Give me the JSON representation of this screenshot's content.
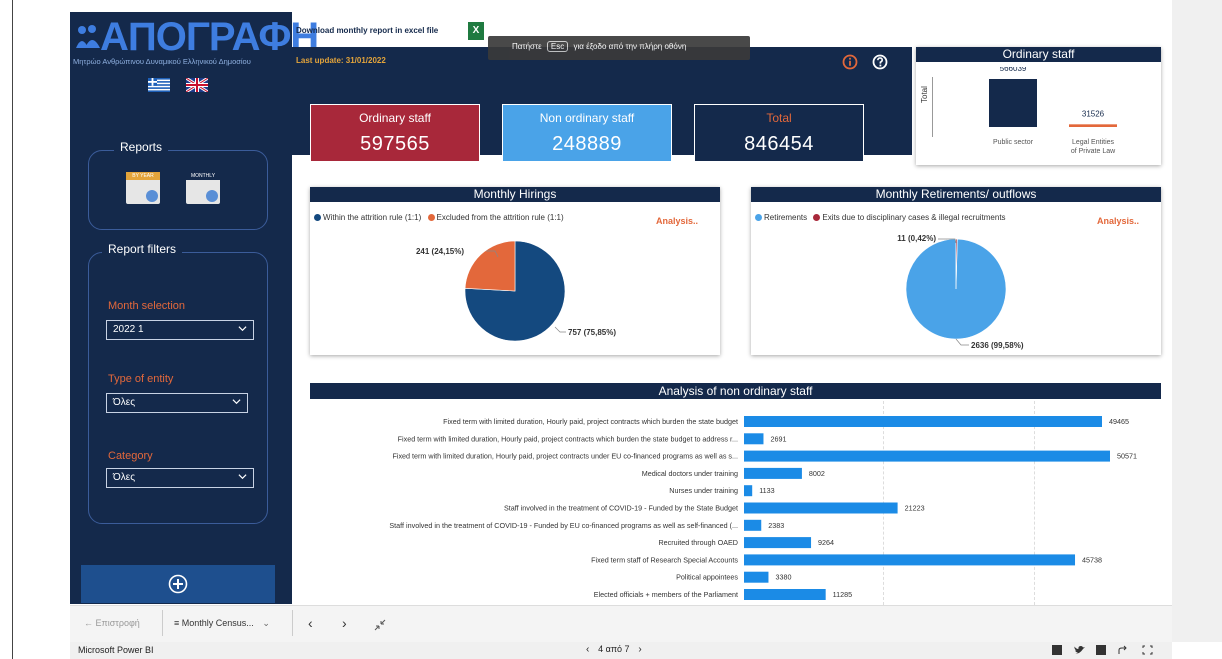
{
  "logo": {
    "title": "ΑΠΟΓΡΑΦΗ",
    "subtitle": "Μητρώο Ανθρώπινου Δυναμικού Ελληνικού Δημοσίου"
  },
  "header": {
    "download_label": "Download monthly report in excel file",
    "excel_icon_letter": "X",
    "last_update": "Last update: 31/01/2022",
    "toast": {
      "before": "Πατήστε",
      "key": "Esc",
      "after": "για έξοδο από την πλήρη οθόνη"
    }
  },
  "sidebar": {
    "reports_title": "Reports",
    "report_icons": [
      {
        "band": "BY YEAR"
      },
      {
        "band": "MONTHLY"
      }
    ],
    "filters_title": "Report filters",
    "filters": [
      {
        "label": "Month selection",
        "value": "2022 1"
      },
      {
        "label": "Type of entity",
        "value": "Όλες"
      },
      {
        "label": "Category",
        "value": "Όλες"
      }
    ]
  },
  "kpis": [
    {
      "title": "Ordinary staff",
      "value": "597565",
      "color": "#a8283a"
    },
    {
      "title": "Non ordinary staff",
      "value": "248889",
      "color": "#4aa3e8"
    },
    {
      "title": "Total",
      "value": "846454",
      "color": "#14294b"
    }
  ],
  "ordinary_panel": {
    "title": "Ordinary staff",
    "axis_label": "Total",
    "chart_data": {
      "type": "bar",
      "categories": [
        "Public sector",
        "Legal Entities of Private Law"
      ],
      "values": [
        566039,
        31526
      ],
      "value_labels": [
        "566039",
        "31526"
      ],
      "category_labels": [
        "Public sector",
        "Legal Entities",
        "of Private Law"
      ],
      "colors": [
        "#14294b",
        "#e3683b"
      ]
    }
  },
  "hirings": {
    "title": "Monthly Hirings",
    "legend": [
      "Within the attrition rule (1:1)",
      "Excluded from the attrition rule (1:1)"
    ],
    "analysis": "Analysis..",
    "chart_data": {
      "type": "pie",
      "categories": [
        "Within the attrition rule (1:1)",
        "Excluded from the attrition rule (1:1)"
      ],
      "values": [
        757,
        241
      ],
      "labels": [
        "757 (75,85%)",
        "241 (24,15%)"
      ],
      "colors": [
        "#14497f",
        "#e3683b"
      ]
    }
  },
  "retirements": {
    "title": "Monthly Retirements/ outflows",
    "legend": [
      "Retirements",
      "Exits due to disciplinary cases & illegal recruitments"
    ],
    "analysis": "Analysis..",
    "chart_data": {
      "type": "pie",
      "categories": [
        "Retirements",
        "Exits due to disciplinary cases & illegal recruitments"
      ],
      "values": [
        2636,
        11
      ],
      "labels": [
        "2636 (99,58%)",
        "11 (0,42%)"
      ],
      "colors": [
        "#4aa3e8",
        "#a8283a"
      ]
    }
  },
  "non_ordinary": {
    "title": "Analysis of non ordinary staff",
    "chart_data": {
      "type": "bar",
      "orientation": "horizontal",
      "xlim": [
        0,
        50571
      ],
      "categories": [
        "Fixed term with limited duration, Hourly paid, project contracts which burden the state budget",
        "Fixed term with limited duration, Hourly paid, project contracts which burden the state budget to address r...",
        "Fixed term with limited duration, Hourly paid, project contracts under EU co-financed programs as well as s...",
        "Medical doctors under training",
        "Nurses under training",
        "Staff involved in the treatment of COVID-19 - Funded by the State Budget",
        "Staff involved in the treatment of COVID-19 - Funded by EU co-financed programs as well as self-financed (...",
        "Recruited through OAED",
        "Fixed term staff of Research Special Accounts",
        "Political appointees",
        "Elected officials + members of the Parliament"
      ],
      "values": [
        49465,
        2691,
        50571,
        8002,
        1133,
        21223,
        2383,
        9264,
        45738,
        3380,
        11285
      ],
      "color": "#1b8be6"
    }
  },
  "bottom": {
    "back": "Επιστροφή",
    "page_menu": "Monthly Census...",
    "page_indicator": "4 από 7",
    "app_name": "Microsoft Power BI"
  }
}
